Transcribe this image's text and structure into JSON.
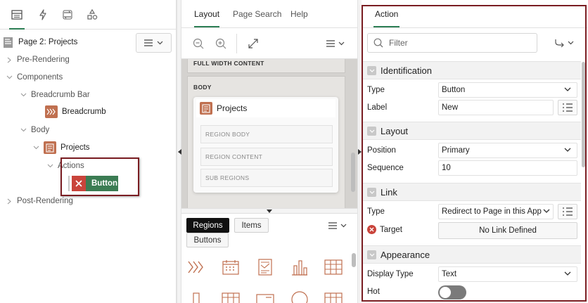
{
  "left_pane": {
    "toolbar_tabs": [
      "rendering-tab",
      "dynamic-actions-tab",
      "processing-tab",
      "shared-components-tab"
    ],
    "page_title": "Page 2: Projects",
    "tree": {
      "pre_rendering": "Pre-Rendering",
      "components": "Components",
      "breadcrumb_bar": "Breadcrumb Bar",
      "breadcrumb": "Breadcrumb",
      "body": "Body",
      "projects": "Projects",
      "actions": "Actions",
      "button": "Button",
      "post_rendering": "Post-Rendering"
    }
  },
  "middle_pane": {
    "tabs": [
      "Layout",
      "Page Search",
      "Help"
    ],
    "canvas": {
      "full_width": "FULL WIDTH CONTENT",
      "body": "BODY",
      "region_title": "Projects",
      "slots": [
        "REGION BODY",
        "REGION CONTENT",
        "SUB REGIONS"
      ]
    },
    "gallery": {
      "tabs": [
        "Regions",
        "Items",
        "Buttons"
      ],
      "active_tab": "Regions"
    }
  },
  "property_editor": {
    "tab": "Action",
    "filter_placeholder": "Filter",
    "sections": {
      "identification": {
        "title": "Identification",
        "type_label": "Type",
        "type_value": "Button",
        "label_label": "Label",
        "label_value": "New"
      },
      "layout": {
        "title": "Layout",
        "position_label": "Position",
        "position_value": "Primary",
        "sequence_label": "Sequence",
        "sequence_value": "10"
      },
      "link": {
        "title": "Link",
        "type_label": "Type",
        "type_value": "Redirect to Page in this App",
        "target_label": "Target",
        "target_value": "No Link Defined"
      },
      "appearance": {
        "title": "Appearance",
        "display_type_label": "Display Type",
        "display_type_value": "Text",
        "hot_label": "Hot",
        "hot_value": false
      }
    }
  },
  "colors": {
    "accent_green": "#2c7e54",
    "button_green": "#3b7c53",
    "error_red": "#c9443b",
    "highlight_border": "#7a1d22",
    "region_icon": "#c07050"
  }
}
